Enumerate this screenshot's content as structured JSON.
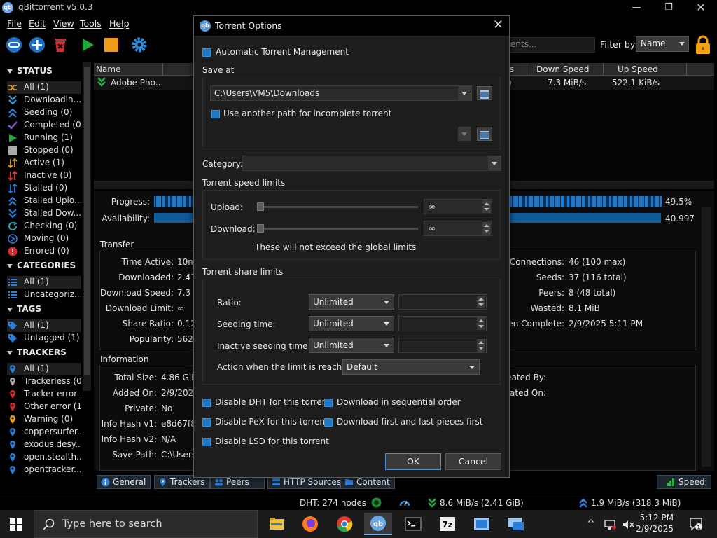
{
  "app": {
    "title": "qBittorrent v5.0.3",
    "icon_text": "qb"
  },
  "menu": [
    "File",
    "Edit",
    "View",
    "Tools",
    "Help"
  ],
  "filter": {
    "placeholder": "ents...",
    "label": "Filter by:",
    "value": "Name"
  },
  "sidebar": {
    "status_title": "STATUS",
    "status_items": [
      {
        "label": "All (1)",
        "icon": "shuffle-icon"
      },
      {
        "label": "Downloadin...",
        "icon": "downloading-icon"
      },
      {
        "label": "Seeding (0)",
        "icon": "seeding-icon"
      },
      {
        "label": "Completed (0)",
        "icon": "completed-icon"
      },
      {
        "label": "Running (1)",
        "icon": "running-icon"
      },
      {
        "label": "Stopped (0)",
        "icon": "stopped-icon"
      },
      {
        "label": "Active (1)",
        "icon": "active-icon"
      },
      {
        "label": "Inactive (0)",
        "icon": "inactive-icon"
      },
      {
        "label": "Stalled (0)",
        "icon": "stalled-icon"
      },
      {
        "label": "Stalled Uplo...",
        "icon": "stalled-upload-icon"
      },
      {
        "label": "Stalled Dow...",
        "icon": "stalled-download-icon"
      },
      {
        "label": "Checking (0)",
        "icon": "checking-icon"
      },
      {
        "label": "Moving (0)",
        "icon": "moving-icon"
      },
      {
        "label": "Errored (0)",
        "icon": "errored-icon"
      }
    ],
    "categories_title": "CATEGORIES",
    "categories_items": [
      "All (1)",
      "Uncategoriz..."
    ],
    "tags_title": "TAGS",
    "tags_items": [
      "All (1)",
      "Untagged (1)"
    ],
    "trackers_title": "TRACKERS",
    "trackers_items": [
      "All (1)",
      "Trackerless (0)",
      "Tracker error ...",
      "Other error (1)",
      "Warning (0)",
      "coppersurfer...",
      "exodus.desy...",
      "open.stealth...",
      "opentracker...."
    ]
  },
  "table": {
    "headers": [
      "Name",
      "s",
      "Down Speed",
      "Up Speed"
    ],
    "row": {
      "name": "Adobe Pho...",
      "col": ")",
      "down": "7.3 MiB/s",
      "up": "522.1 KiB/s"
    }
  },
  "lower": {
    "progress_label": "Progress:",
    "progress_value": "49.5%",
    "progress_fraction": 0.495,
    "availability_label": "Availability:",
    "availability_value": "40.997",
    "transfer_title": "Transfer",
    "transfer_left": [
      {
        "label": "Time Active:",
        "value": "10m"
      },
      {
        "label": "Downloaded:",
        "value": "2.41"
      },
      {
        "label": "Download Speed:",
        "value": "7.3 M"
      },
      {
        "label": "Download Limit:",
        "value": "∞"
      },
      {
        "label": "Share Ratio:",
        "value": "0.12"
      },
      {
        "label": "Popularity:",
        "value": "562.8"
      }
    ],
    "transfer_right": [
      {
        "label": "Connections:",
        "value": "46 (100 max)"
      },
      {
        "label": "Seeds:",
        "value": "37 (116 total)"
      },
      {
        "label": "Peers:",
        "value": "8 (48 total)"
      },
      {
        "label": "Wasted:",
        "value": "8.1 MiB"
      },
      {
        "label": "een Complete:",
        "value": "2/9/2025 5:11 PM"
      }
    ],
    "info_title": "Information",
    "info_left": [
      {
        "label": "Total Size:",
        "value": "4.86 GiB"
      },
      {
        "label": "Added On:",
        "value": "2/9/2025"
      },
      {
        "label": "Private:",
        "value": "No"
      },
      {
        "label": "Info Hash v1:",
        "value": "e8d67f8f"
      },
      {
        "label": "Info Hash v2:",
        "value": "N/A"
      },
      {
        "label": "Save Path:",
        "value": "C:\\Users\\"
      }
    ],
    "info_right": [
      {
        "label": "reated By:"
      },
      {
        "label": "reated On:"
      }
    ]
  },
  "tabs": [
    "General",
    "Trackers",
    "Peers",
    "HTTP Sources",
    "Content"
  ],
  "speed_button": "Speed",
  "statusbar": {
    "dht": "DHT: 274 nodes",
    "down": "8.6 MiB/s (2.41 GiB)",
    "up": "1.9 MiB/s (318.3 MiB)"
  },
  "taskbar": {
    "search_text": "Type here to search",
    "time": "5:12 PM",
    "date": "2/9/2025"
  },
  "dialog": {
    "title": "Torrent Options",
    "auto_mgmt": "Automatic Torrent Management",
    "save_at": "Save at",
    "save_path": "C:\\Users\\VM5\\Downloads",
    "use_another_path": "Use another path for incomplete torrent",
    "category_label": "Category:",
    "speed_title": "Torrent speed limits",
    "upload_label": "Upload:",
    "upload_value": "∞",
    "download_label": "Download:",
    "download_value": "∞",
    "speed_note": "These will not exceed the global limits",
    "share_title": "Torrent share limits",
    "ratio_label": "Ratio:",
    "ratio_value": "Unlimited",
    "seeding_label": "Seeding time:",
    "seeding_value": "Unlimited",
    "inactive_label": "Inactive seeding time:",
    "inactive_value": "Unlimited",
    "action_label": "Action when the limit is reached:",
    "action_value": "Default",
    "disable_dht": "Disable DHT for this torrent",
    "sequential": "Download in sequential order",
    "disable_pex": "Disable PeX for this torrent",
    "first_last": "Download first and last pieces first",
    "disable_lsd": "Disable LSD for this torrent",
    "ok": "OK",
    "cancel": "Cancel"
  },
  "colors": {
    "accent": "#1f77c8",
    "progress": "#0f5a99",
    "dialog_bg": "#1e1e1e"
  }
}
